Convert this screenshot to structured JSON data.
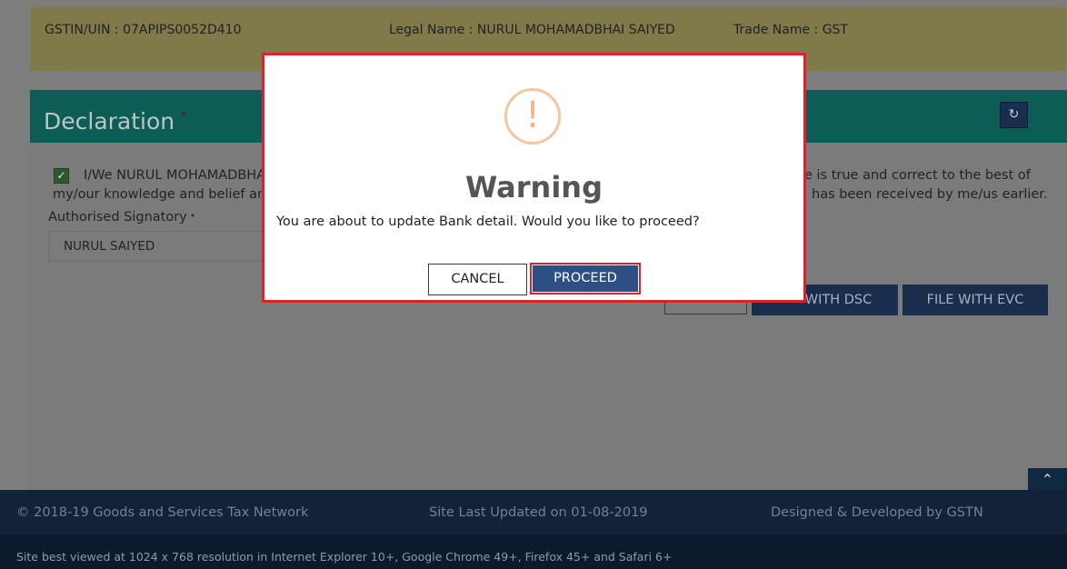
{
  "header": {
    "gstin": "GSTIN/UIN : 07APIPS0052D410",
    "legal_name": "Legal Name : NURUL MOHAMADBHAI SAIYED",
    "trade_name": "Trade Name : GST"
  },
  "declaration": {
    "title": "Declaration",
    "required_mark": "•",
    "refresh_icon": "refresh-icon",
    "checkbox_checked": true,
    "checkmark_glyph": "✓",
    "line1_left": "I/We NURUL MOHAMADBHA",
    "line1_right": "e is true and correct to the best of",
    "line2_left": "my/our knowledge and belief and",
    "line2_right": "has been received by me/us earlier.",
    "signatory_label": "Authorised Signatory",
    "signatory_value": "NURUL SAIYED",
    "btn_dsc": "WITH DSC",
    "btn_evc": "FILE WITH EVC"
  },
  "scroll_top_icon": "chevron-up-icon",
  "footer": {
    "copyright": "© 2018-19 Goods and Services Tax Network",
    "last_updated": "Site Last Updated on 01-08-2019",
    "designed_by": "Designed & Developed by GSTN",
    "best_viewed": "Site best viewed at 1024 x 768 resolution in Internet Explorer 10+, Google Chrome 49+, Firefox 45+ and Safari 6+"
  },
  "modal": {
    "icon": "warning-exclamation-icon",
    "icon_glyph": "!",
    "title": "Warning",
    "message": "You are about to update Bank detail. Would you like to proceed?",
    "cancel_label": "CANCEL",
    "proceed_label": "PROCEED"
  },
  "colors": {
    "modal_border": "#d9232d",
    "proceed_bg": "#2e4f84",
    "warning_icon": "#f6c5a0",
    "panel_header": "#0d5d57"
  }
}
